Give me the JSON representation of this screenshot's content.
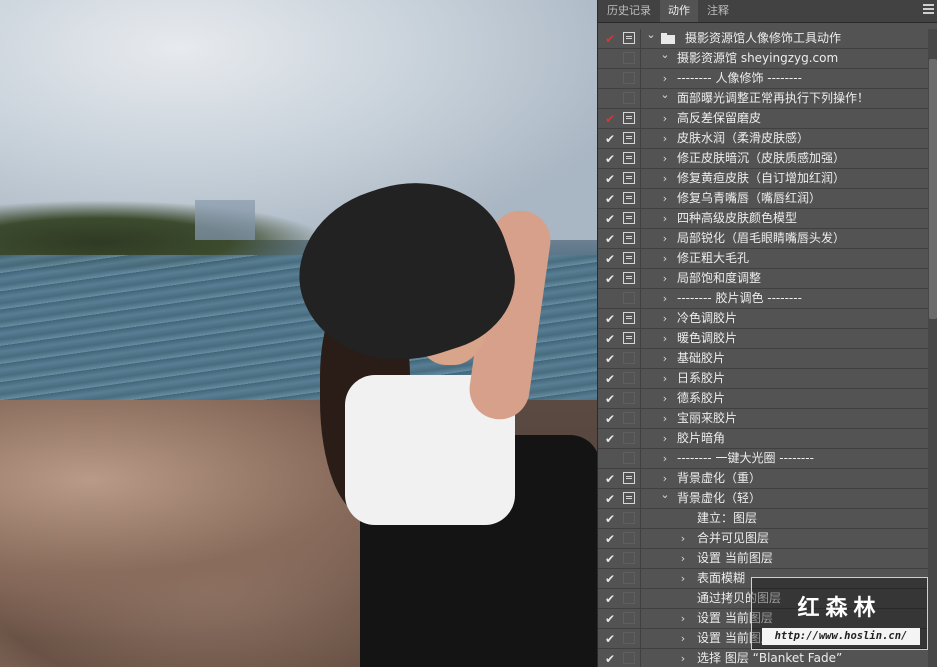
{
  "panel": {
    "tabs": [
      {
        "label": "历史记录",
        "active": false
      },
      {
        "label": "动作",
        "active": true
      },
      {
        "label": "注释",
        "active": false
      }
    ],
    "menu_icon": "panel-menu-icon"
  },
  "actions": [
    {
      "label": "摄影资源馆人像修饰工具动作",
      "level": 0,
      "checked": true,
      "check_red": true,
      "dialog": true,
      "expanded": true,
      "folder": true
    },
    {
      "label": "摄影资源馆 sheyingzyg.com",
      "level": 1,
      "checked": false,
      "dialog": false,
      "expanded": true
    },
    {
      "label": "-------- 人像修饰 --------",
      "level": 1,
      "checked": false,
      "dialog": false,
      "expanded": false
    },
    {
      "label": "面部曝光调整正常再执行下列操作！",
      "level": 1,
      "checked": false,
      "dialog": false,
      "expanded": true
    },
    {
      "label": "高反差保留磨皮",
      "level": 1,
      "checked": true,
      "check_red": true,
      "dialog": true,
      "expanded": false
    },
    {
      "label": "皮肤水润（柔滑皮肤感）",
      "level": 1,
      "checked": true,
      "dialog": true,
      "expanded": false
    },
    {
      "label": "修正皮肤暗沉（皮肤质感加强）",
      "level": 1,
      "checked": true,
      "dialog": true,
      "expanded": false
    },
    {
      "label": "修复黄疸皮肤（自订增加红润）",
      "level": 1,
      "checked": true,
      "dialog": true,
      "expanded": false
    },
    {
      "label": "修复乌青嘴唇（嘴唇红润）",
      "level": 1,
      "checked": true,
      "dialog": true,
      "expanded": false
    },
    {
      "label": "四种高级皮肤颜色模型",
      "level": 1,
      "checked": true,
      "dialog": true,
      "expanded": false
    },
    {
      "label": "局部锐化（眉毛眼睛嘴唇头发）",
      "level": 1,
      "checked": true,
      "dialog": true,
      "expanded": false
    },
    {
      "label": "修正粗大毛孔",
      "level": 1,
      "checked": true,
      "dialog": true,
      "expanded": false
    },
    {
      "label": "局部饱和度调整",
      "level": 1,
      "checked": true,
      "dialog": true,
      "expanded": false
    },
    {
      "label": "-------- 胶片调色 --------",
      "level": 1,
      "checked": false,
      "dialog": false,
      "expanded": false
    },
    {
      "label": "冷色调胶片",
      "level": 1,
      "checked": true,
      "dialog": true,
      "expanded": false
    },
    {
      "label": "暖色调胶片",
      "level": 1,
      "checked": true,
      "dialog": true,
      "expanded": false
    },
    {
      "label": "基础胶片",
      "level": 1,
      "checked": true,
      "dialog": false,
      "expanded": false
    },
    {
      "label": "日系胶片",
      "level": 1,
      "checked": true,
      "dialog": false,
      "expanded": false
    },
    {
      "label": "德系胶片",
      "level": 1,
      "checked": true,
      "dialog": false,
      "expanded": false
    },
    {
      "label": "宝丽来胶片",
      "level": 1,
      "checked": true,
      "dialog": false,
      "expanded": false
    },
    {
      "label": "胶片暗角",
      "level": 1,
      "checked": true,
      "dialog": false,
      "expanded": false
    },
    {
      "label": "-------- 一键大光圈 --------",
      "level": 1,
      "checked": false,
      "dialog": false,
      "expanded": false
    },
    {
      "label": "背景虚化（重）",
      "level": 1,
      "checked": true,
      "dialog": true,
      "expanded": false
    },
    {
      "label": "背景虚化（轻）",
      "level": 1,
      "checked": true,
      "dialog": true,
      "expanded": true
    },
    {
      "label": "建立：图层",
      "level": 2,
      "checked": true,
      "dialog": false,
      "expanded": null
    },
    {
      "label": "合并可见图层",
      "level": 2,
      "checked": true,
      "dialog": false,
      "expanded": false
    },
    {
      "label": "设置 当前图层",
      "level": 2,
      "checked": true,
      "dialog": false,
      "expanded": false
    },
    {
      "label": "表面模糊",
      "level": 2,
      "checked": true,
      "dialog": false,
      "expanded": false
    },
    {
      "label": "通过拷贝的图层",
      "level": 2,
      "checked": true,
      "dialog": false,
      "expanded": null
    },
    {
      "label": "设置 当前图层",
      "level": 2,
      "checked": true,
      "dialog": false,
      "expanded": false
    },
    {
      "label": "设置 当前图层",
      "level": 2,
      "checked": true,
      "dialog": false,
      "expanded": false
    },
    {
      "label": "选择 图层 “Blanket Fade”",
      "level": 2,
      "checked": true,
      "dialog": false,
      "expanded": false
    }
  ],
  "watermark": {
    "title": "红森林",
    "url": "http://www.hoslin.cn/"
  }
}
